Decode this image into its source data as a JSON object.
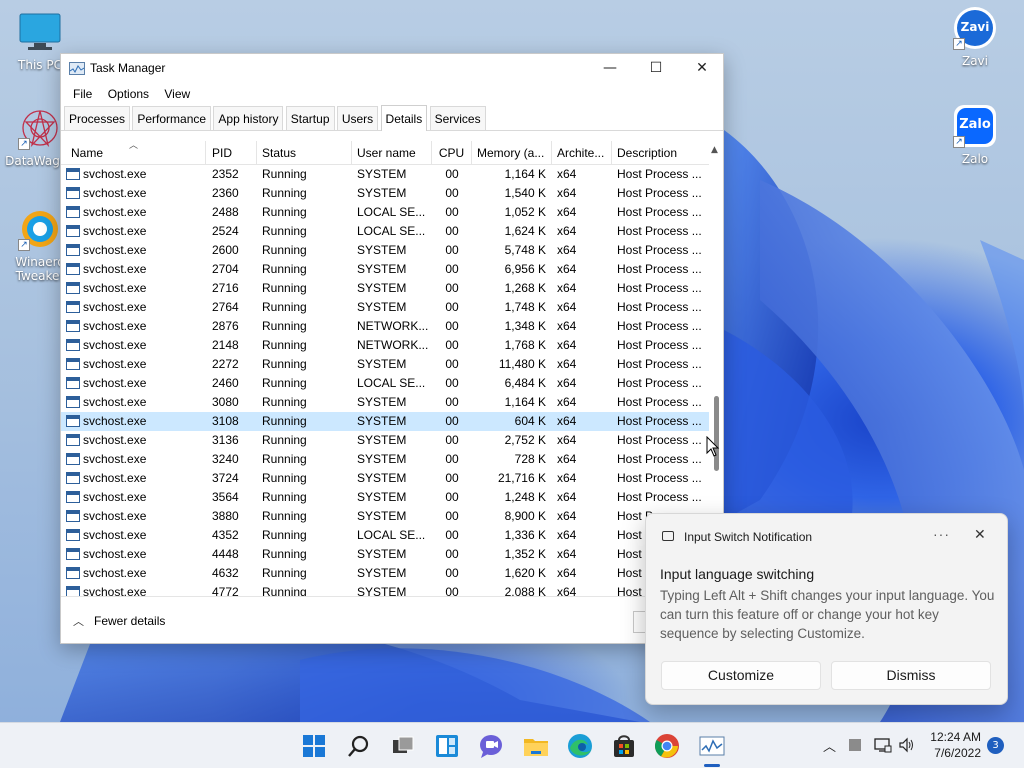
{
  "desktop": {
    "icons": [
      {
        "label": "This PC"
      },
      {
        "label": "DataWagon"
      },
      {
        "label": "Winaero Tweaker"
      },
      {
        "label": "Zavi"
      },
      {
        "label": "Zalo"
      }
    ],
    "zavi_logo_text": "Zavi",
    "zalo_logo_text": "Zalo"
  },
  "task_manager": {
    "title": "Task Manager",
    "menu": [
      "File",
      "Options",
      "View"
    ],
    "tabs": [
      "Processes",
      "Performance",
      "App history",
      "Startup",
      "Users",
      "Details",
      "Services"
    ],
    "active_tab": "Details",
    "columns": [
      "Name",
      "PID",
      "Status",
      "User name",
      "CPU",
      "Memory (a...",
      "Archite...",
      "Description"
    ],
    "rows": [
      {
        "name": "svchost.exe",
        "pid": "2352",
        "status": "Running",
        "user": "SYSTEM",
        "cpu": "00",
        "mem": "1,164 K",
        "arch": "x64",
        "desc": "Host Process ..."
      },
      {
        "name": "svchost.exe",
        "pid": "2360",
        "status": "Running",
        "user": "SYSTEM",
        "cpu": "00",
        "mem": "1,540 K",
        "arch": "x64",
        "desc": "Host Process ..."
      },
      {
        "name": "svchost.exe",
        "pid": "2488",
        "status": "Running",
        "user": "LOCAL SE...",
        "cpu": "00",
        "mem": "1,052 K",
        "arch": "x64",
        "desc": "Host Process ..."
      },
      {
        "name": "svchost.exe",
        "pid": "2524",
        "status": "Running",
        "user": "LOCAL SE...",
        "cpu": "00",
        "mem": "1,624 K",
        "arch": "x64",
        "desc": "Host Process ..."
      },
      {
        "name": "svchost.exe",
        "pid": "2600",
        "status": "Running",
        "user": "SYSTEM",
        "cpu": "00",
        "mem": "5,748 K",
        "arch": "x64",
        "desc": "Host Process ..."
      },
      {
        "name": "svchost.exe",
        "pid": "2704",
        "status": "Running",
        "user": "SYSTEM",
        "cpu": "00",
        "mem": "6,956 K",
        "arch": "x64",
        "desc": "Host Process ..."
      },
      {
        "name": "svchost.exe",
        "pid": "2716",
        "status": "Running",
        "user": "SYSTEM",
        "cpu": "00",
        "mem": "1,268 K",
        "arch": "x64",
        "desc": "Host Process ..."
      },
      {
        "name": "svchost.exe",
        "pid": "2764",
        "status": "Running",
        "user": "SYSTEM",
        "cpu": "00",
        "mem": "1,748 K",
        "arch": "x64",
        "desc": "Host Process ..."
      },
      {
        "name": "svchost.exe",
        "pid": "2876",
        "status": "Running",
        "user": "NETWORK...",
        "cpu": "00",
        "mem": "1,348 K",
        "arch": "x64",
        "desc": "Host Process ..."
      },
      {
        "name": "svchost.exe",
        "pid": "2148",
        "status": "Running",
        "user": "NETWORK...",
        "cpu": "00",
        "mem": "1,768 K",
        "arch": "x64",
        "desc": "Host Process ..."
      },
      {
        "name": "svchost.exe",
        "pid": "2272",
        "status": "Running",
        "user": "SYSTEM",
        "cpu": "00",
        "mem": "11,480 K",
        "arch": "x64",
        "desc": "Host Process ..."
      },
      {
        "name": "svchost.exe",
        "pid": "2460",
        "status": "Running",
        "user": "LOCAL SE...",
        "cpu": "00",
        "mem": "6,484 K",
        "arch": "x64",
        "desc": "Host Process ..."
      },
      {
        "name": "svchost.exe",
        "pid": "3080",
        "status": "Running",
        "user": "SYSTEM",
        "cpu": "00",
        "mem": "1,164 K",
        "arch": "x64",
        "desc": "Host Process ..."
      },
      {
        "name": "svchost.exe",
        "pid": "3108",
        "status": "Running",
        "user": "SYSTEM",
        "cpu": "00",
        "mem": "604 K",
        "arch": "x64",
        "desc": "Host Process ...",
        "selected": true
      },
      {
        "name": "svchost.exe",
        "pid": "3136",
        "status": "Running",
        "user": "SYSTEM",
        "cpu": "00",
        "mem": "2,752 K",
        "arch": "x64",
        "desc": "Host Process ..."
      },
      {
        "name": "svchost.exe",
        "pid": "3240",
        "status": "Running",
        "user": "SYSTEM",
        "cpu": "00",
        "mem": "728 K",
        "arch": "x64",
        "desc": "Host Process ..."
      },
      {
        "name": "svchost.exe",
        "pid": "3724",
        "status": "Running",
        "user": "SYSTEM",
        "cpu": "00",
        "mem": "21,716 K",
        "arch": "x64",
        "desc": "Host Process ..."
      },
      {
        "name": "svchost.exe",
        "pid": "3564",
        "status": "Running",
        "user": "SYSTEM",
        "cpu": "00",
        "mem": "1,248 K",
        "arch": "x64",
        "desc": "Host Process ..."
      },
      {
        "name": "svchost.exe",
        "pid": "3880",
        "status": "Running",
        "user": "SYSTEM",
        "cpu": "00",
        "mem": "8,900 K",
        "arch": "x64",
        "desc": "Host P"
      },
      {
        "name": "svchost.exe",
        "pid": "4352",
        "status": "Running",
        "user": "LOCAL SE...",
        "cpu": "00",
        "mem": "1,336 K",
        "arch": "x64",
        "desc": "Host"
      },
      {
        "name": "svchost.exe",
        "pid": "4448",
        "status": "Running",
        "user": "SYSTEM",
        "cpu": "00",
        "mem": "1,352 K",
        "arch": "x64",
        "desc": "Host"
      },
      {
        "name": "svchost.exe",
        "pid": "4632",
        "status": "Running",
        "user": "SYSTEM",
        "cpu": "00",
        "mem": "1,620 K",
        "arch": "x64",
        "desc": "Host"
      },
      {
        "name": "svchost.exe",
        "pid": "4772",
        "status": "Running",
        "user": "SYSTEM",
        "cpu": "00",
        "mem": "2,088 K",
        "arch": "x64",
        "desc": "Host"
      }
    ],
    "fewer_details_label": "Fewer details"
  },
  "notification": {
    "app_name": "Input Switch Notification",
    "title": "Input language switching",
    "body": "Typing Left Alt + Shift changes your input language. You can turn this feature off or change your hot key sequence by selecting Customize.",
    "customize_label": "Customize",
    "dismiss_label": "Dismiss"
  },
  "taskbar": {
    "time": "12:24 AM",
    "date": "7/6/2022",
    "notification_count": "3",
    "accent_color": "#1f5fbf"
  }
}
